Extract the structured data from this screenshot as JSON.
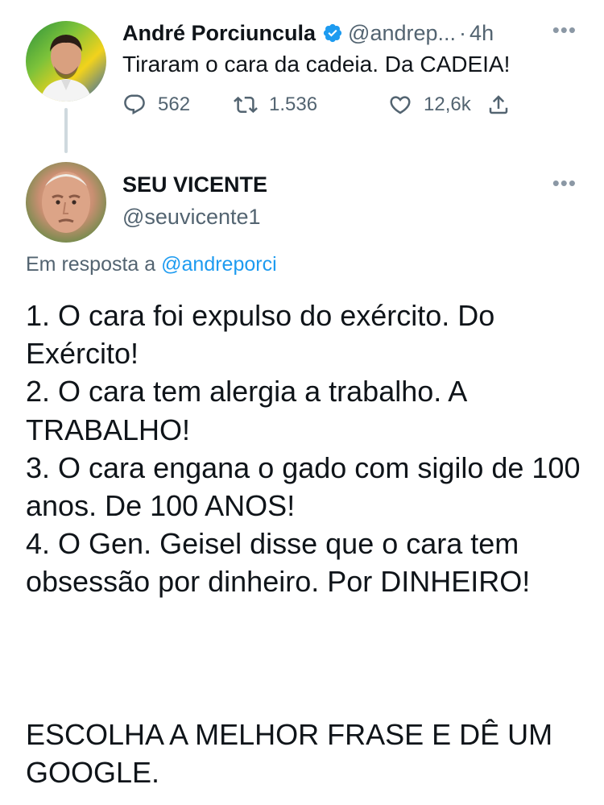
{
  "parent_tweet": {
    "author_name": "André Porciuncula",
    "handle": "@andrep...",
    "separator": "·",
    "time": "4h",
    "text": "Tiraram o cara da cadeia. Da CADEIA!",
    "replies": "562",
    "retweets": "1.536",
    "likes": "12,6k",
    "more_icon": "more-icon"
  },
  "reply_tweet": {
    "author_name": "SEU VICENTE",
    "handle": "@seuvicente1",
    "reply_prefix": "Em resposta a",
    "reply_to_handle": "@andreporci",
    "lines": [
      "1. O cara foi expulso do exército. Do Exército!",
      "2. O cara tem alergia a trabalho. A TRABALHO!",
      "3. O cara engana o gado com sigilo de 100 anos. De 100 ANOS!",
      "4. O Gen. Geisel disse que o cara tem obsessão por dinheiro. Por DINHEIRO!"
    ],
    "closing": "ESCOLHA A MELHOR FRASE E DÊ UM GOOGLE."
  },
  "colors": {
    "text": "#0f1419",
    "secondary": "#536471",
    "link": "#1d9bf0",
    "verified": "#1d9bf0",
    "thread_line": "#cfd9de"
  },
  "icons": [
    "verified-badge-icon",
    "reply-icon",
    "retweet-icon",
    "like-icon",
    "share-icon",
    "more-icon"
  ]
}
